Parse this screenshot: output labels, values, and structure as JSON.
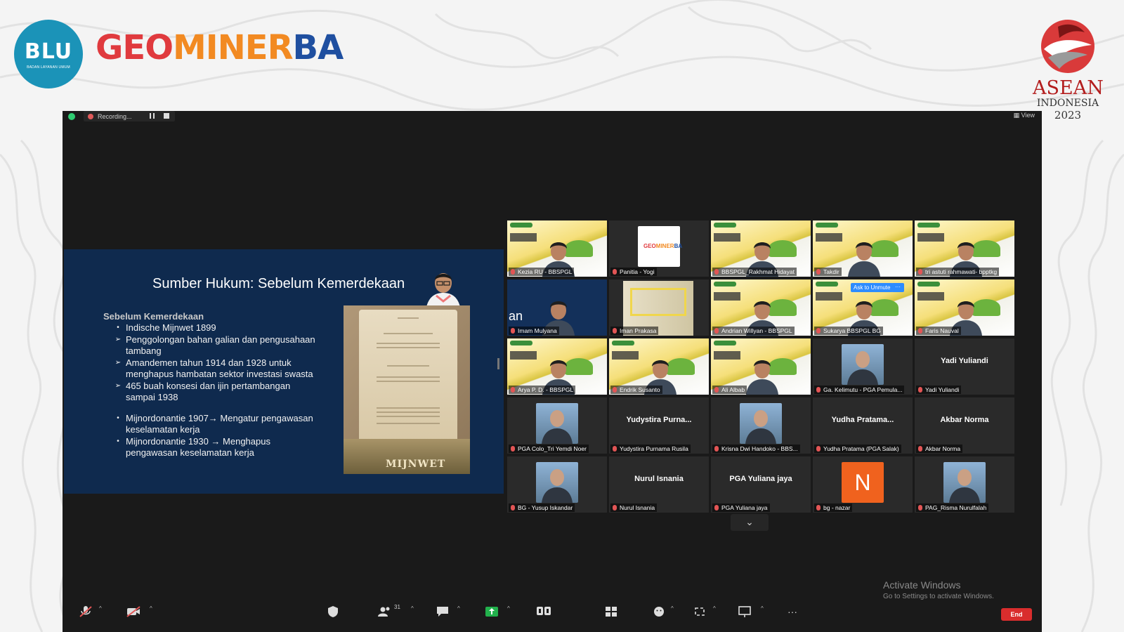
{
  "header": {
    "blu_logo_text": "BLU",
    "blu_logo_sub": "BADAN LAYANAN UMUM",
    "brand_part1": "GEO",
    "brand_part2": "MINER",
    "brand_part3": "BA",
    "asean_line1": "ASEAN",
    "asean_line2": "INDONESIA",
    "asean_line3": "2023"
  },
  "meeting": {
    "recording_label": "Recording...",
    "view_label": "View"
  },
  "slide": {
    "title": "Sumber Hukum: Sebelum Kemerdekaan",
    "subtitle": "Sebelum Kemerdekaan",
    "bullets": [
      {
        "symbol": "•",
        "text": "Indische Mijnwet 1899"
      },
      {
        "symbol": "➢",
        "text": "Penggolongan bahan galian dan pengusahaan tambang"
      },
      {
        "symbol": "➢",
        "text": "Amandemen tahun 1914 dan 1928 untuk menghapus hambatan sektor investasi swasta"
      },
      {
        "symbol": "➢",
        "text": "465 buah konsesi dan ijin pertambangan sampai 1938"
      },
      {
        "symbol": "•",
        "text": "Mijnordonantie 1907→ Mengatur pengawasan keselamatan kerja"
      },
      {
        "symbol": "•",
        "text": "Mijnordonantie 1930 → Menghapus pengawasan keselamatan kerja"
      }
    ],
    "doc_caption": "MIJNWET"
  },
  "participants": [
    {
      "name": "Kezia RU - BBSPGL",
      "type": "video"
    },
    {
      "name": "Panitia - Yogi",
      "type": "logo"
    },
    {
      "name": "BBSPGL_Rakhmat Hidayat",
      "type": "video"
    },
    {
      "name": "Takdir",
      "type": "video"
    },
    {
      "name": "tri astuti rahmawati- bpptkg",
      "type": "video"
    },
    {
      "name": "Imam Mulyana",
      "type": "video",
      "active": true,
      "side_text": "an"
    },
    {
      "name": "Iman Prakasa",
      "type": "room"
    },
    {
      "name": "Andrian Willyan - BBSPGL",
      "type": "video"
    },
    {
      "name": "Sukarya BBSPGL BG",
      "type": "video",
      "ask_unmute": "Ask to Unmute",
      "more": "···"
    },
    {
      "name": "Faris Nauval",
      "type": "video"
    },
    {
      "name": "Arya P. D. - BBSPGL",
      "type": "video"
    },
    {
      "name": "Endrik Susanto",
      "type": "video"
    },
    {
      "name": "Ali Albab",
      "type": "video"
    },
    {
      "name": "Ga. Kelimutu - PGA Pemula...",
      "type": "photo"
    },
    {
      "name": "Yadi Yuliandi",
      "type": "text",
      "center": "Yadi Yuliandi"
    },
    {
      "name": "PGA Colo_Tri Yemdi Noer",
      "type": "photo"
    },
    {
      "name": "Yudystira Purnama Rusila",
      "type": "text",
      "center": "Yudystira  Purna..."
    },
    {
      "name": "Krisna Dwi Handoko - BBS...",
      "type": "photo"
    },
    {
      "name": "Yudha Pratama (PGA Salak)",
      "type": "text",
      "center": "Yudha  Pratama..."
    },
    {
      "name": "Akbar Norma",
      "type": "text",
      "center": "Akbar Norma"
    },
    {
      "name": "BG - Yusup Iskandar",
      "type": "photo"
    },
    {
      "name": "Nurul Isnania",
      "type": "text",
      "center": "Nurul Isnania"
    },
    {
      "name": "PGA Yuliana jaya",
      "type": "text",
      "center": "PGA Yuliana jaya"
    },
    {
      "name": "bg - nazar",
      "type": "initial",
      "initial": "N"
    },
    {
      "name": "PAG_Risma Nurulfalah",
      "type": "photo"
    }
  ],
  "gallery_scroll": "⌄",
  "activate_windows": {
    "title": "Activate Windows",
    "subtitle": "Go to Settings to activate Windows."
  },
  "toolbar": {
    "participants_count": "31",
    "end_label": "End",
    "icons": [
      "microphone-muted-icon",
      "video-off-icon",
      "security-icon",
      "participants-icon",
      "chat-icon",
      "share-screen-icon",
      "record-icon",
      "breakout-rooms-icon",
      "reactions-icon",
      "apps-icon",
      "whiteboards-icon",
      "more-icon"
    ]
  },
  "colors": {
    "zoom_bg": "#1a1a1a",
    "slide_bg": "#0f2a4e",
    "active_speaker": "#e4d96b",
    "end_button": "#d92d2d",
    "brand_red": "#e03a3e",
    "brand_orange": "#f28a22",
    "brand_blue": "#1f4fa0"
  }
}
